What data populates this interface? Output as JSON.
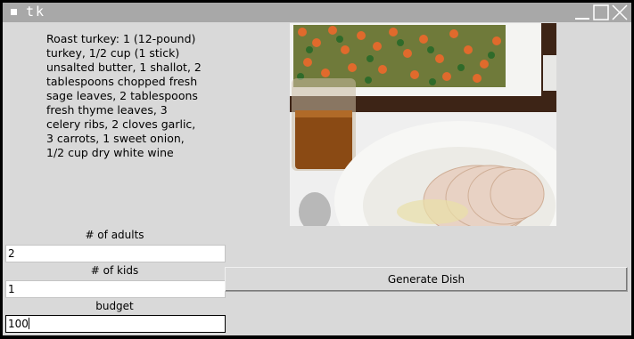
{
  "window": {
    "title": "tk"
  },
  "recipe": {
    "text": "Roast turkey: 1 (12-pound) turkey, 1/2 cup (1 stick) unsalted butter, 1 shallot, 2 tablespoons chopped fresh sage leaves, 2 tablespoons fresh thyme leaves, 3 celery ribs, 2 cloves garlic, 3 carrots, 1 sweet onion, 1/2 cup dry white wine"
  },
  "image": {
    "subject": "roast turkey dish photo"
  },
  "form": {
    "adults_label": "# of adults",
    "adults_value": "2",
    "kids_label": "# of kids",
    "kids_value": "1",
    "budget_label": "budget",
    "budget_value": "100"
  },
  "actions": {
    "generate_label": "Generate Dish"
  }
}
